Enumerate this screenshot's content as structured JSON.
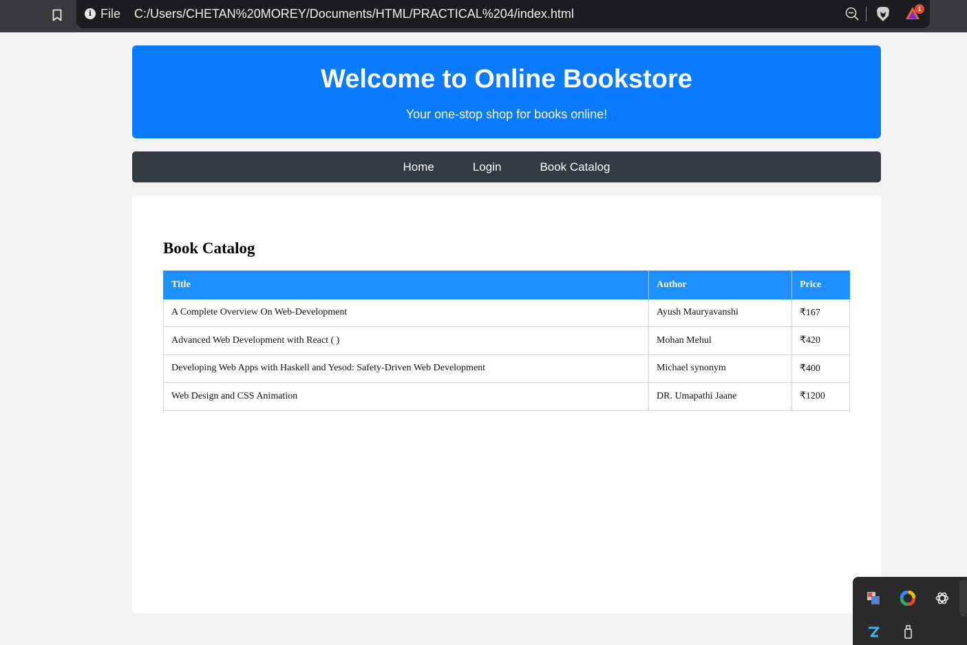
{
  "browser": {
    "scheme_label": "File",
    "url": "C:/Users/CHETAN%20MOREY/Documents/HTML/PRACTICAL%204/index.html",
    "rewards_badge_count": "1"
  },
  "header": {
    "title": "Welcome to Online Bookstore",
    "subtitle": "Your one-stop shop for books online!"
  },
  "nav": {
    "items": [
      "Home",
      "Login",
      "Book Catalog"
    ]
  },
  "catalog": {
    "heading": "Book Catalog",
    "columns": [
      "Title",
      "Author",
      "Price"
    ],
    "rows": [
      [
        "A Complete Overview On Web-Development",
        "Ayush Mauryavanshi",
        "₹167"
      ],
      [
        "Advanced Web Development with React ( )",
        "Mohan Mehul",
        "₹420"
      ],
      [
        "Developing Web Apps with Haskell and Yesod: Safety-Driven Web Development",
        "Michael synonym",
        "₹400"
      ],
      [
        "Web Design and CSS Animation",
        "DR. Umapathi Jaane",
        "₹1200"
      ]
    ]
  },
  "colors": {
    "header_bg": "#0a7bff",
    "nav_bg": "#343a40",
    "table_header_bg": "#1e90ff"
  }
}
